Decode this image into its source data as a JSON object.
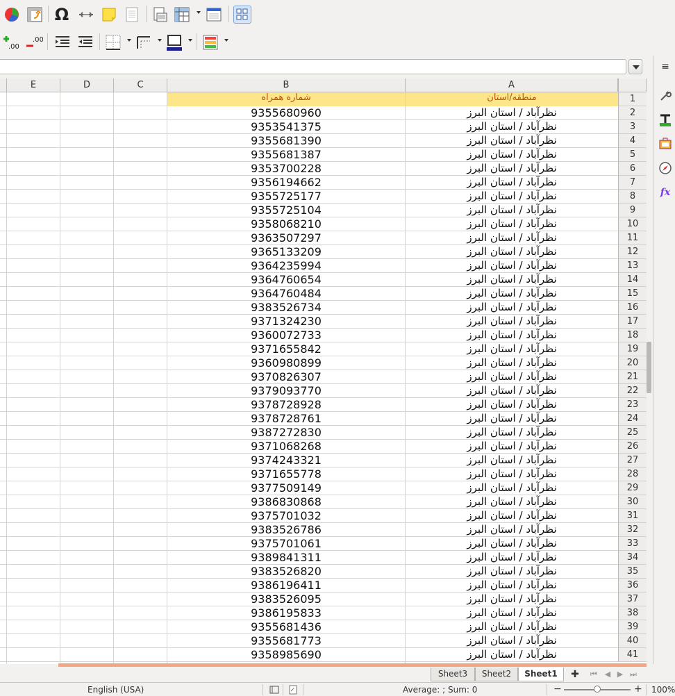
{
  "columns": [
    "E",
    "D",
    "C",
    "B",
    "A"
  ],
  "header_row": {
    "row": "1",
    "A": "منطقه/استان",
    "B": "شماره همراه"
  },
  "rows": [
    {
      "n": "2",
      "A": "نظرآباد / استان البرز",
      "B": "9355680960"
    },
    {
      "n": "3",
      "A": "نظرآباد / استان البرز",
      "B": "9353541375"
    },
    {
      "n": "4",
      "A": "نظرآباد / استان البرز",
      "B": "9355681390"
    },
    {
      "n": "5",
      "A": "نظرآباد / استان البرز",
      "B": "9355681387"
    },
    {
      "n": "6",
      "A": "نظرآباد / استان البرز",
      "B": "9353700228"
    },
    {
      "n": "7",
      "A": "نظرآباد / استان البرز",
      "B": "9356194662"
    },
    {
      "n": "8",
      "A": "نظرآباد / استان البرز",
      "B": "9355725177"
    },
    {
      "n": "9",
      "A": "نظرآباد / استان البرز",
      "B": "9355725104"
    },
    {
      "n": "10",
      "A": "نظرآباد / استان البرز",
      "B": "9358068210"
    },
    {
      "n": "11",
      "A": "نظرآباد / استان البرز",
      "B": "9363507297"
    },
    {
      "n": "12",
      "A": "نظرآباد / استان البرز",
      "B": "9365133209"
    },
    {
      "n": "13",
      "A": "نظرآباد / استان البرز",
      "B": "9364235994"
    },
    {
      "n": "14",
      "A": "نظرآباد / استان البرز",
      "B": "9364760654"
    },
    {
      "n": "15",
      "A": "نظرآباد / استان البرز",
      "B": "9364760484"
    },
    {
      "n": "16",
      "A": "نظرآباد / استان البرز",
      "B": "9383526734"
    },
    {
      "n": "17",
      "A": "نظرآباد / استان البرز",
      "B": "9371324230"
    },
    {
      "n": "18",
      "A": "نظرآباد / استان البرز",
      "B": "9360072733"
    },
    {
      "n": "19",
      "A": "نظرآباد / استان البرز",
      "B": "9371655842"
    },
    {
      "n": "20",
      "A": "نظرآباد / استان البرز",
      "B": "9360980899"
    },
    {
      "n": "21",
      "A": "نظرآباد / استان البرز",
      "B": "9370826307"
    },
    {
      "n": "22",
      "A": "نظرآباد / استان البرز",
      "B": "9379093770"
    },
    {
      "n": "23",
      "A": "نظرآباد / استان البرز",
      "B": "9378728928"
    },
    {
      "n": "24",
      "A": "نظرآباد / استان البرز",
      "B": "9378728761"
    },
    {
      "n": "25",
      "A": "نظرآباد / استان البرز",
      "B": "9387272830"
    },
    {
      "n": "26",
      "A": "نظرآباد / استان البرز",
      "B": "9371068268"
    },
    {
      "n": "27",
      "A": "نظرآباد / استان البرز",
      "B": "9374243321"
    },
    {
      "n": "28",
      "A": "نظرآباد / استان البرز",
      "B": "9371655778"
    },
    {
      "n": "29",
      "A": "نظرآباد / استان البرز",
      "B": "9377509149"
    },
    {
      "n": "30",
      "A": "نظرآباد / استان البرز",
      "B": "9386830868"
    },
    {
      "n": "31",
      "A": "نظرآباد / استان البرز",
      "B": "9375701032"
    },
    {
      "n": "32",
      "A": "نظرآباد / استان البرز",
      "B": "9383526786"
    },
    {
      "n": "33",
      "A": "نظرآباد / استان البرز",
      "B": "9375701061"
    },
    {
      "n": "34",
      "A": "نظرآباد / استان البرز",
      "B": "9389841311"
    },
    {
      "n": "35",
      "A": "نظرآباد / استان البرز",
      "B": "9383526820"
    },
    {
      "n": "36",
      "A": "نظرآباد / استان البرز",
      "B": "9386196411"
    },
    {
      "n": "37",
      "A": "نظرآباد / استان البرز",
      "B": "9383526095"
    },
    {
      "n": "38",
      "A": "نظرآباد / استان البرز",
      "B": "9386195833"
    },
    {
      "n": "39",
      "A": "نظرآباد / استان البرز",
      "B": "9355681436"
    },
    {
      "n": "40",
      "A": "نظرآباد / استان البرز",
      "B": "9355681773"
    },
    {
      "n": "41",
      "A": "نظرآباد / استان البرز",
      "B": "9358985690"
    }
  ],
  "sheet_tabs": [
    {
      "label": "Sheet3",
      "active": false
    },
    {
      "label": "Sheet2",
      "active": false
    },
    {
      "label": "Sheet1",
      "active": true
    }
  ],
  "status": {
    "language": "English (USA)",
    "sum_text": "Average: ; Sum: 0",
    "zoom_minus": "−",
    "zoom_plus": "+",
    "zoom_level": "100%",
    "zoom_fraction": 0.5
  },
  "toolbar": {
    "omega_glyph": "Ω",
    "add_tab_glyph": "✚",
    "icons": [
      "chart-icon",
      "pivot-table-icon",
      "special-character-icon",
      "hyperlink-icon",
      "comment-icon",
      "header-footer-icon",
      "print-range-icon",
      "freeze-rows-icon",
      "headers-icon",
      "toggle-grid-icon",
      "add-decimal-icon",
      "delete-decimal-icon",
      "increase-indent-icon",
      "decrease-indent-icon",
      "borders-icon",
      "border-style-icon",
      "border-color-icon",
      "conditional-format-icon"
    ]
  },
  "colors": {
    "header_fill": "#fde68a",
    "header_text": "#b45309",
    "sheet_bottom_bar": "#f4a582",
    "border_color_swatch": "#1f1f8f"
  }
}
